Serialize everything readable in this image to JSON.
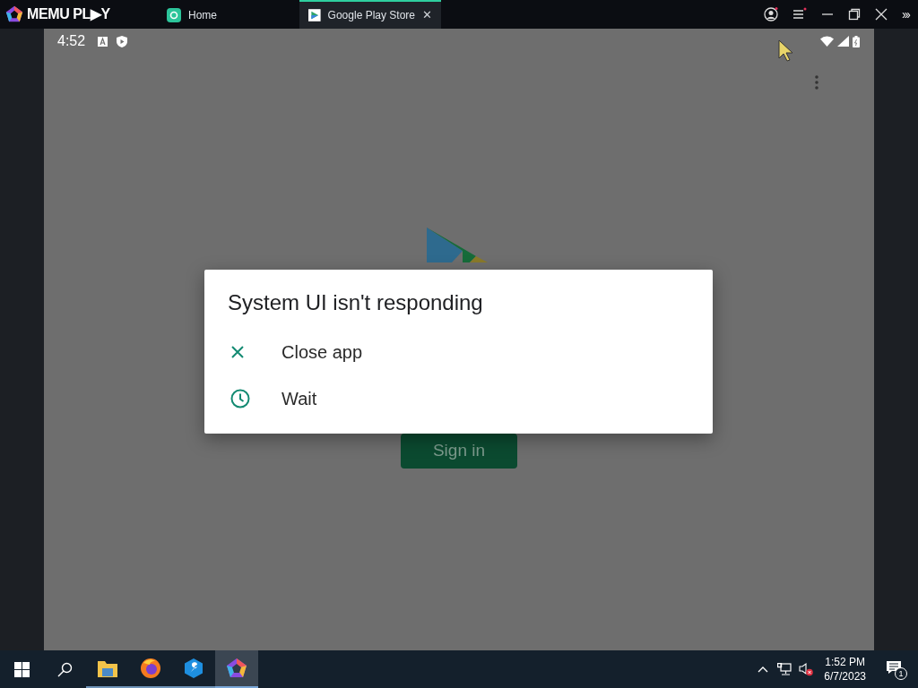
{
  "titlebar": {
    "logo": "MEMU PL▶Y",
    "tabs": [
      {
        "label": "Home",
        "selected": false
      },
      {
        "label": "Google Play Store",
        "selected": true
      }
    ],
    "close_glyph": "✕",
    "more_glyph": "›››"
  },
  "android": {
    "status_bar": {
      "time": "4:52"
    },
    "background": {
      "sign_in": "Sign in"
    },
    "dialog": {
      "title": "System UI isn't responding",
      "options": [
        {
          "kind": "close",
          "label": "Close app"
        },
        {
          "kind": "wait",
          "label": "Wait"
        }
      ]
    }
  },
  "taskbar": {
    "apps": [
      {
        "kind": "folder",
        "selected": false
      },
      {
        "kind": "firefox",
        "selected": false
      },
      {
        "kind": "tool",
        "selected": false
      },
      {
        "kind": "memu",
        "selected": true
      }
    ],
    "time": "1:52 PM",
    "date": "6/7/2023",
    "notifications": "1"
  }
}
